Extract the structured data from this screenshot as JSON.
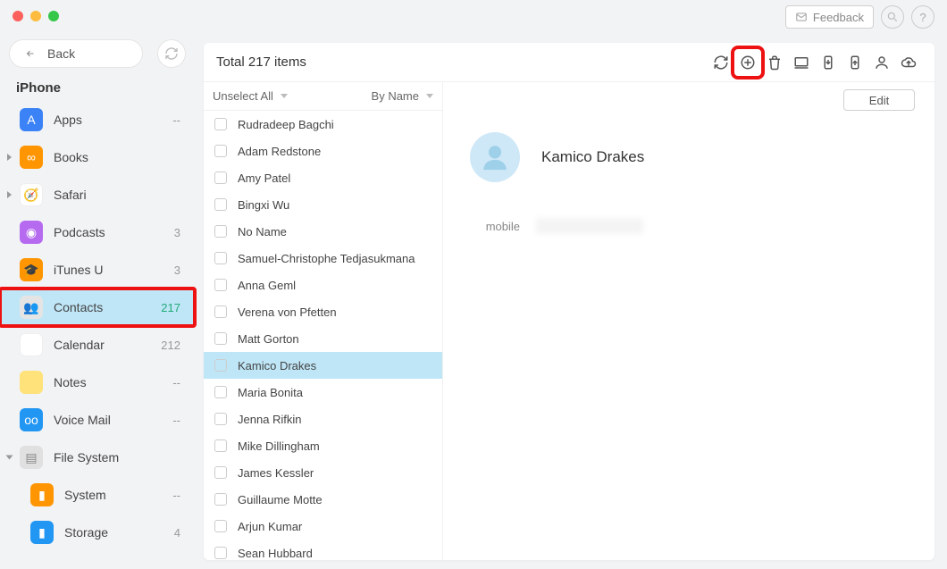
{
  "titlebar": {
    "feedback": "Feedback"
  },
  "sidebar": {
    "back": "Back",
    "device": "iPhone",
    "items": [
      {
        "label": "Apps",
        "count": "--"
      },
      {
        "label": "Books",
        "count": ""
      },
      {
        "label": "Safari",
        "count": ""
      },
      {
        "label": "Podcasts",
        "count": "3"
      },
      {
        "label": "iTunes U",
        "count": "3"
      },
      {
        "label": "Contacts",
        "count": "217"
      },
      {
        "label": "Calendar",
        "count": "212"
      },
      {
        "label": "Notes",
        "count": "--"
      },
      {
        "label": "Voice Mail",
        "count": "--"
      },
      {
        "label": "File System",
        "count": ""
      },
      {
        "label": "System",
        "count": "--"
      },
      {
        "label": "Storage",
        "count": "4"
      }
    ]
  },
  "main": {
    "total": "Total 217 items",
    "unselect": "Unselect All",
    "sort": "By Name",
    "edit": "Edit"
  },
  "contacts": [
    "Rudradeep Bagchi",
    "Adam Redstone",
    "Amy Patel",
    "Bingxi Wu",
    "No Name",
    "Samuel-Christophe Tedjasukmana",
    "Anna Geml",
    "Verena von Pfetten",
    "Matt Gorton",
    "Kamico Drakes",
    "Maria Bonita",
    "Jenna Rifkin",
    "Mike Dillingham",
    "James Kessler",
    "Guillaume Motte",
    "Arjun Kumar",
    "Sean Hubbard"
  ],
  "selected_index": 9,
  "detail": {
    "name": "Kamico  Drakes",
    "field_label": "mobile"
  }
}
